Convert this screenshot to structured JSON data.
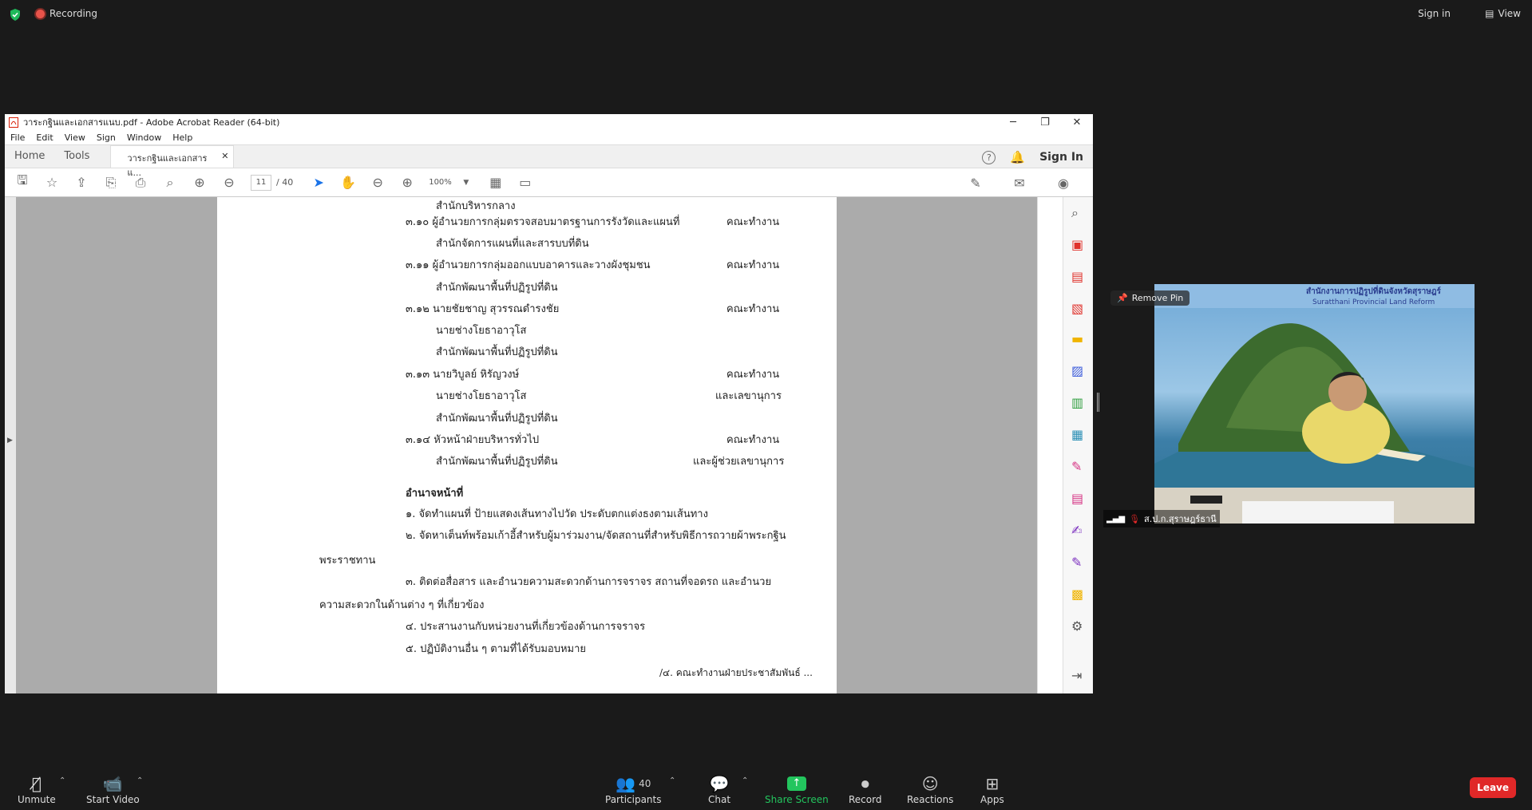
{
  "zoom_top": {
    "recording_label": "Recording",
    "sign_in": "Sign in",
    "view": "View"
  },
  "acrobat": {
    "title": "วาระกฐินและเอกสารแนบ.pdf - Adobe Acrobat Reader (64-bit)",
    "menu": [
      "File",
      "Edit",
      "View",
      "Sign",
      "Window",
      "Help"
    ],
    "tabs": {
      "home": "Home",
      "tools": "Tools",
      "doc": "วาระกฐินและเอกสารแ..."
    },
    "sign_in": "Sign In",
    "help_glyph": "?",
    "current_page": "11",
    "total_pages": "/ 40",
    "zoom": "100%"
  },
  "page": {
    "lines": [
      {
        "text": "สำนักบริหารกลาง"
      },
      {
        "text": "๓.๑๐ ผู้อำนวยการกลุ่มตรวจสอบมาตรฐานการรังวัดและแผนที่"
      },
      {
        "text": "คณะทำงาน"
      },
      {
        "text": "สำนักจัดการแผนที่และสารบบที่ดิน"
      },
      {
        "text": "๓.๑๑ ผู้อำนวยการกลุ่มออกแบบอาคารและวางผังชุมชน"
      },
      {
        "text": "คณะทำงาน"
      },
      {
        "text": "สำนักพัฒนาพื้นที่ปฏิรูปที่ดิน"
      },
      {
        "text": "๓.๑๒ นายชัยชาญ  สุวรรณดำรงชัย"
      },
      {
        "text": "คณะทำงาน"
      },
      {
        "text": "นายช่างโยธาอาวุโส"
      },
      {
        "text": "สำนักพัฒนาพื้นที่ปฏิรูปที่ดิน"
      },
      {
        "text": "๓.๑๓ นายวิบูลย์  หิรัญวงษ์"
      },
      {
        "text": "คณะทำงาน"
      },
      {
        "text": "นายช่างโยธาอาวุโส"
      },
      {
        "text": "และเลขานุการ"
      },
      {
        "text": "สำนักพัฒนาพื้นที่ปฏิรูปที่ดิน"
      },
      {
        "text": "๓.๑๔ หัวหน้าฝ่ายบริหารทั่วไป"
      },
      {
        "text": "คณะทำงาน"
      },
      {
        "text": "สำนักพัฒนาพื้นที่ปฏิรูปที่ดิน"
      },
      {
        "text": "และผู้ช่วยเลขานุการ"
      },
      {
        "text": "อำนาจหน้าที่"
      },
      {
        "text": "๑. จัดทำแผนที่ ป้ายแสดงเส้นทางไปวัด ประดับตกแต่งธงตามเส้นทาง"
      },
      {
        "text": "๒. จัดหาเต็นท์พร้อมเก้าอี้สำหรับผู้มาร่วมงาน/จัดสถานที่สำหรับพิธีการถวายผ้าพระกฐิน"
      },
      {
        "text": "พระราชทาน"
      },
      {
        "text": "๓. ติดต่อสื่อสาร และอำนวยความสะดวกด้านการจราจร สถานที่จอดรถ และอำนวย"
      },
      {
        "text": "ความสะดวกในด้านต่าง ๆ ที่เกี่ยวข้อง"
      },
      {
        "text": "๔. ประสานงานกับหน่วยงานที่เกี่ยวข้องด้านการจราจร"
      },
      {
        "text": "๕. ปฏิบัติงานอื่น ๆ ตามที่ได้รับมอบหมาย"
      },
      {
        "text": "/๔. คณะทำงานฝ่ายประชาสัมพันธ์ ..."
      }
    ]
  },
  "video": {
    "remove_pin": "Remove Pin",
    "participant_name": "ส.ป.ก.สุราษฎร์ธานี",
    "banner_text": "สำนักงานการปฏิรูปที่ดินจังหวัดสุราษฎร์",
    "banner_sub": "Suratthani Provincial Land Reform"
  },
  "bottom": {
    "unmute": "Unmute",
    "start_video": "Start Video",
    "participants": "Participants",
    "participant_count": "40",
    "chat": "Chat",
    "share_screen": "Share Screen",
    "record": "Record",
    "reactions": "Reactions",
    "apps": "Apps",
    "leave": "Leave"
  },
  "colors": {
    "share_green": "#23c55e",
    "leave_red": "#e02828",
    "acrobat_red": "#d81e05"
  }
}
